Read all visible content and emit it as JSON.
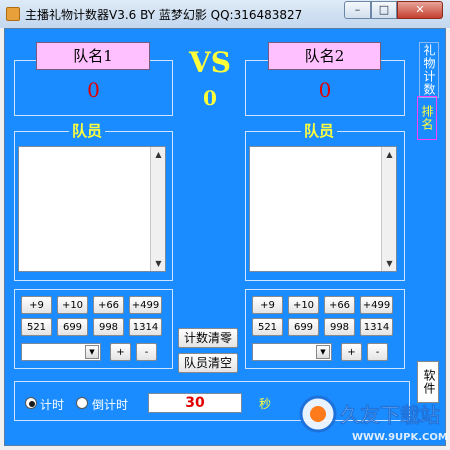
{
  "window": {
    "title": "主播礼物计数器V3.6  BY 蓝梦幻影 QQ:316483827",
    "min_glyph": "–",
    "max_glyph": "□",
    "close_glyph": "✕"
  },
  "left_team": {
    "name": "队名1",
    "score": "0",
    "members_legend": "队员",
    "gift_buttons_row1": [
      "+9",
      "+10",
      "+66",
      "+499"
    ],
    "gift_buttons_row2": [
      "521",
      "699",
      "998",
      "1314"
    ],
    "plus_label": "+",
    "minus_label": "-",
    "combo_value": ""
  },
  "right_team": {
    "name": "队名2",
    "score": "0",
    "members_legend": "队员",
    "gift_buttons_row1": [
      "+9",
      "+10",
      "+66",
      "+499"
    ],
    "gift_buttons_row2": [
      "521",
      "699",
      "998",
      "1314"
    ],
    "plus_label": "+",
    "minus_label": "-",
    "combo_value": ""
  },
  "center": {
    "vs_label": "VS",
    "vs_value": "0",
    "clear_count_label": "计数清零",
    "clear_members_label": "队员清空"
  },
  "side_tabs": {
    "gifts": "礼物计数",
    "rank": "排名",
    "soft": "软件"
  },
  "timer": {
    "count_up_label": "计时",
    "count_down_label": "倒计时",
    "selected": "count_up",
    "value": "30",
    "seconds_label": "秒"
  },
  "watermark": {
    "brand": "久友下载站",
    "url": "WWW.9UPK.COM"
  },
  "colors": {
    "client_bg": "#1a8cff",
    "team_name_bg": "#ffc0ff",
    "score": "#e00000",
    "accent_yellow": "#ffff3a"
  }
}
